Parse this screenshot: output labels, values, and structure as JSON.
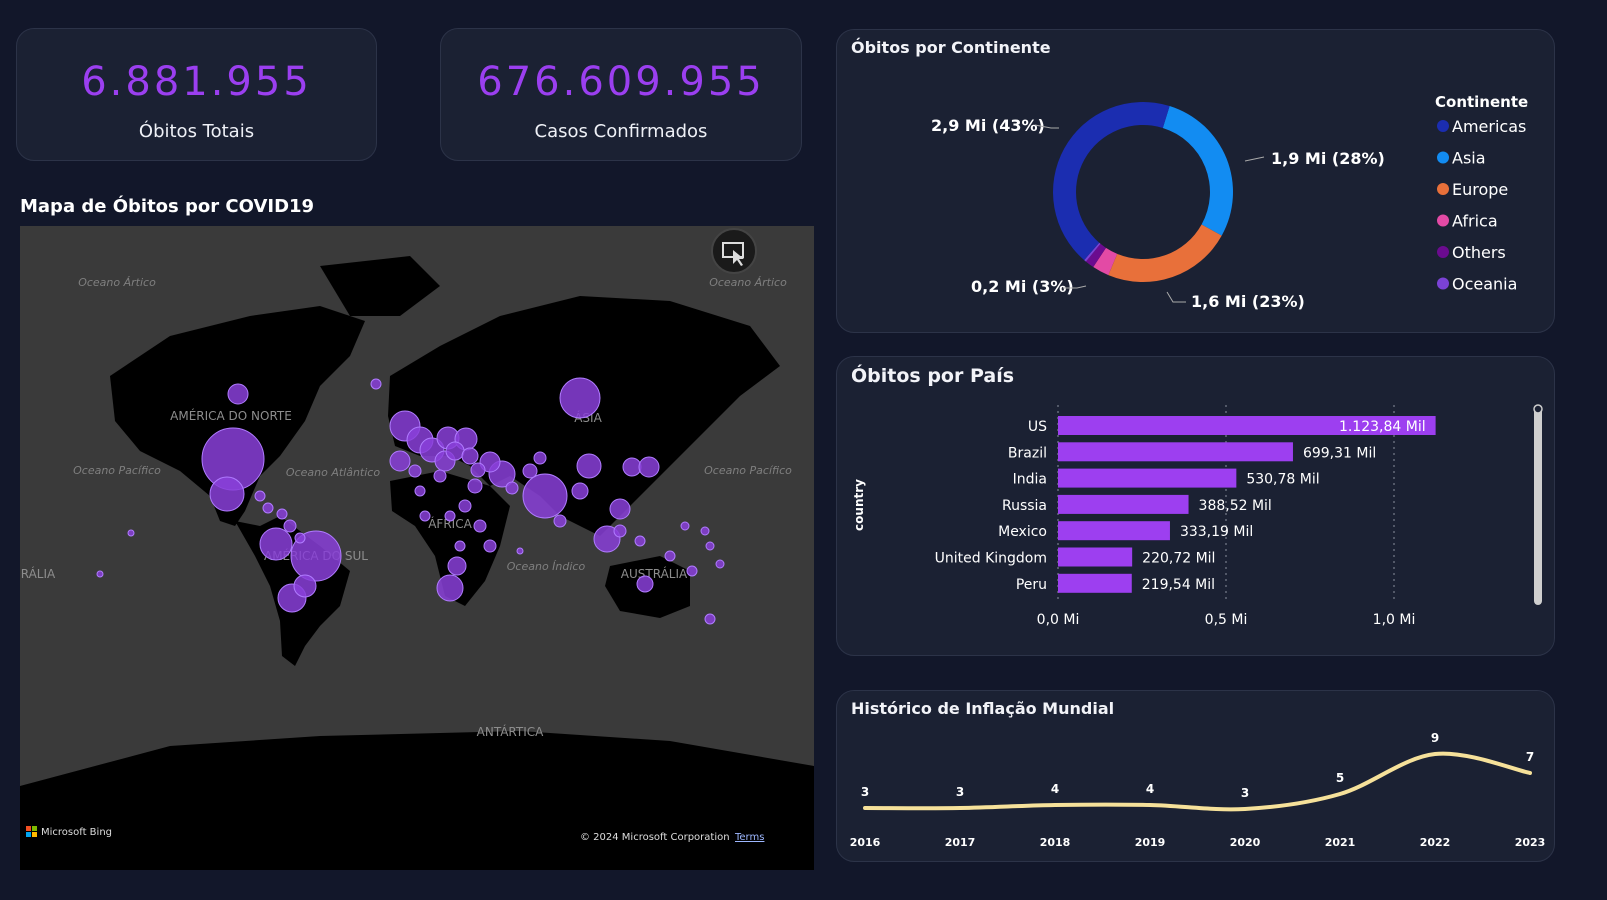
{
  "kpis": [
    {
      "value": "6.881.955",
      "label": "Óbitos Totais"
    },
    {
      "value": "676.609.955",
      "label": "Casos Confirmados"
    }
  ],
  "map": {
    "title": "Mapa de Óbitos por COVID19",
    "labels": {
      "oceano_artico_left": "Oceano Ártico",
      "oceano_artico_right": "Oceano Ártico",
      "america_norte": "AMÉRICA DO NORTE",
      "oceano_pacifico_left": "Oceano Pacífico",
      "oceano_atlantico": "Oceano Atlântico",
      "asia": "ÁSIA",
      "africa": "ÁFRICA",
      "america_sul": "AMÉRICA DO SUL",
      "oceano_indico": "Oceano Índico",
      "oceano_pacifico_right": "Oceano Pacífico",
      "australia_left": "RÁLIA",
      "australia": "AUSTRÁLIA",
      "antartica": "ANTÁRTICA"
    },
    "bing_label": "Microsoft Bing",
    "copyright": "© 2024 Microsoft Corporation",
    "terms": "Terms",
    "focus_icon": "focus-mode-icon",
    "bubble_color": "#8a3fd9"
  },
  "continents": {
    "title": "Óbitos por Continente",
    "legend_title": "Continente",
    "items": [
      {
        "name": "Americas",
        "value": 43,
        "color": "#1b2db0"
      },
      {
        "name": "Asia",
        "value": 28,
        "color": "#128cf2"
      },
      {
        "name": "Europe",
        "value": 23,
        "color": "#e8703a"
      },
      {
        "name": "Africa",
        "value": 3,
        "color": "#e34aa5"
      },
      {
        "name": "Others",
        "value": 1.6,
        "color": "#6b0b8f"
      },
      {
        "name": "Oceania",
        "value": 0.4,
        "color": "#7b42d6"
      }
    ],
    "labels": {
      "americas": "2,9 Mi (43%)",
      "asia": "1,9 Mi (28%)",
      "europe": "1,6 Mi (23%)",
      "africa": "0,2 Mi (3%)"
    }
  },
  "countries": {
    "title": "Óbitos por País",
    "axis_label": "country",
    "ticks": [
      "0,0 Mi",
      "0,5 Mi",
      "1,0 Mi"
    ],
    "bar_color": "#9d3ff0",
    "chart_data": {
      "type": "bar",
      "categories": [
        "US",
        "Brazil",
        "India",
        "Russia",
        "Mexico",
        "United Kingdom",
        "Peru"
      ],
      "values": [
        1123.84,
        699.31,
        530.78,
        388.52,
        333.19,
        220.72,
        219.54
      ],
      "value_labels": [
        "1.123,84 Mil",
        "699,31 Mil",
        "530,78 Mil",
        "388,52 Mil",
        "333,19 Mil",
        "220,72 Mil",
        "219,54 Mil"
      ],
      "xlim": [
        0,
        1200
      ]
    }
  },
  "inflation": {
    "title": "Histórico de Inflação Mundial",
    "line_color": "#f6e19a",
    "chart_data": {
      "type": "line",
      "x": [
        "2016",
        "2017",
        "2018",
        "2019",
        "2020",
        "2021",
        "2022",
        "2023"
      ],
      "values": [
        3.3,
        3.3,
        3.6,
        3.6,
        3.2,
        4.7,
        8.7,
        6.8
      ],
      "value_labels": [
        "3",
        "3",
        "4",
        "4",
        "3",
        "5",
        "9",
        "7"
      ]
    }
  }
}
